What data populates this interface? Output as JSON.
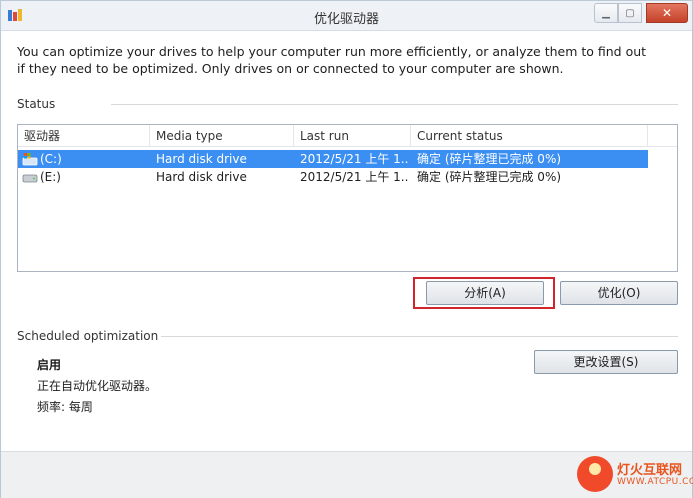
{
  "window": {
    "title": "优化驱动器"
  },
  "intro": {
    "text": "You can optimize your drives to help your computer run more efficiently, or analyze them to find out if they need to be optimized. Only drives on or connected to your computer are shown."
  },
  "status": {
    "label": "Status",
    "columns": [
      "驱动器",
      "Media type",
      "Last run",
      "Current status"
    ],
    "rows": [
      {
        "drive": "(C:)",
        "media": "Hard disk drive",
        "last_run": "2012/5/21 上午 1...",
        "status": "确定 (碎片整理已完成 0%)",
        "icon": "system-drive-icon",
        "selected": true
      },
      {
        "drive": "(E:)",
        "media": "Hard disk drive",
        "last_run": "2012/5/21 上午 1...",
        "status": "确定 (碎片整理已完成 0%)",
        "icon": "hard-drive-icon",
        "selected": false
      }
    ]
  },
  "buttons": {
    "analyze": "分析(A)",
    "optimize": "优化(O)",
    "change_settings": "更改设置(S)"
  },
  "schedule": {
    "label": "Scheduled optimization",
    "state": "启用",
    "description": "正在自动优化驱动器。",
    "frequency": "频率: 每周"
  },
  "watermark": {
    "line1": "灯火互联网",
    "line2": "WWW.ATCPU.COM"
  },
  "colors": {
    "selection": "#3b8ff2",
    "highlight_box": "#d0252b",
    "close_button": "#c4422a"
  }
}
